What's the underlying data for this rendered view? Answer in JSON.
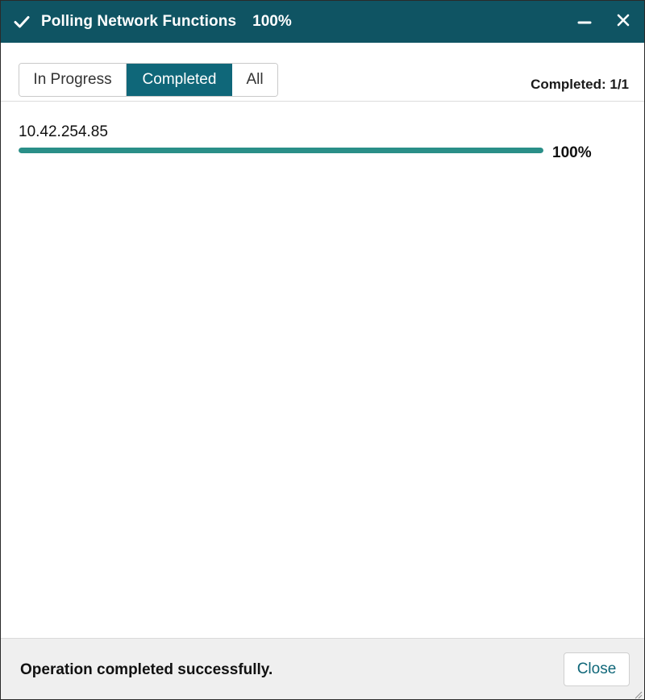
{
  "window": {
    "title": "Polling Network Functions",
    "title_percent": "100%",
    "icons": {
      "status": "checkmark-icon",
      "minimize": "minimize-icon",
      "close": "close-icon"
    },
    "colors": {
      "titlebar": "#0f5463",
      "active_tab": "#0f6779",
      "progress": "#2a8f88"
    }
  },
  "tabs": [
    {
      "label": "In Progress",
      "active": false
    },
    {
      "label": "Completed",
      "active": true
    },
    {
      "label": "All",
      "active": false
    }
  ],
  "summary": "Completed: 1/1",
  "tasks": [
    {
      "name": "10.42.254.85",
      "progress": 1.0,
      "percent_label": "100%"
    }
  ],
  "footer": {
    "message": "Operation completed successfully.",
    "close_label": "Close"
  }
}
